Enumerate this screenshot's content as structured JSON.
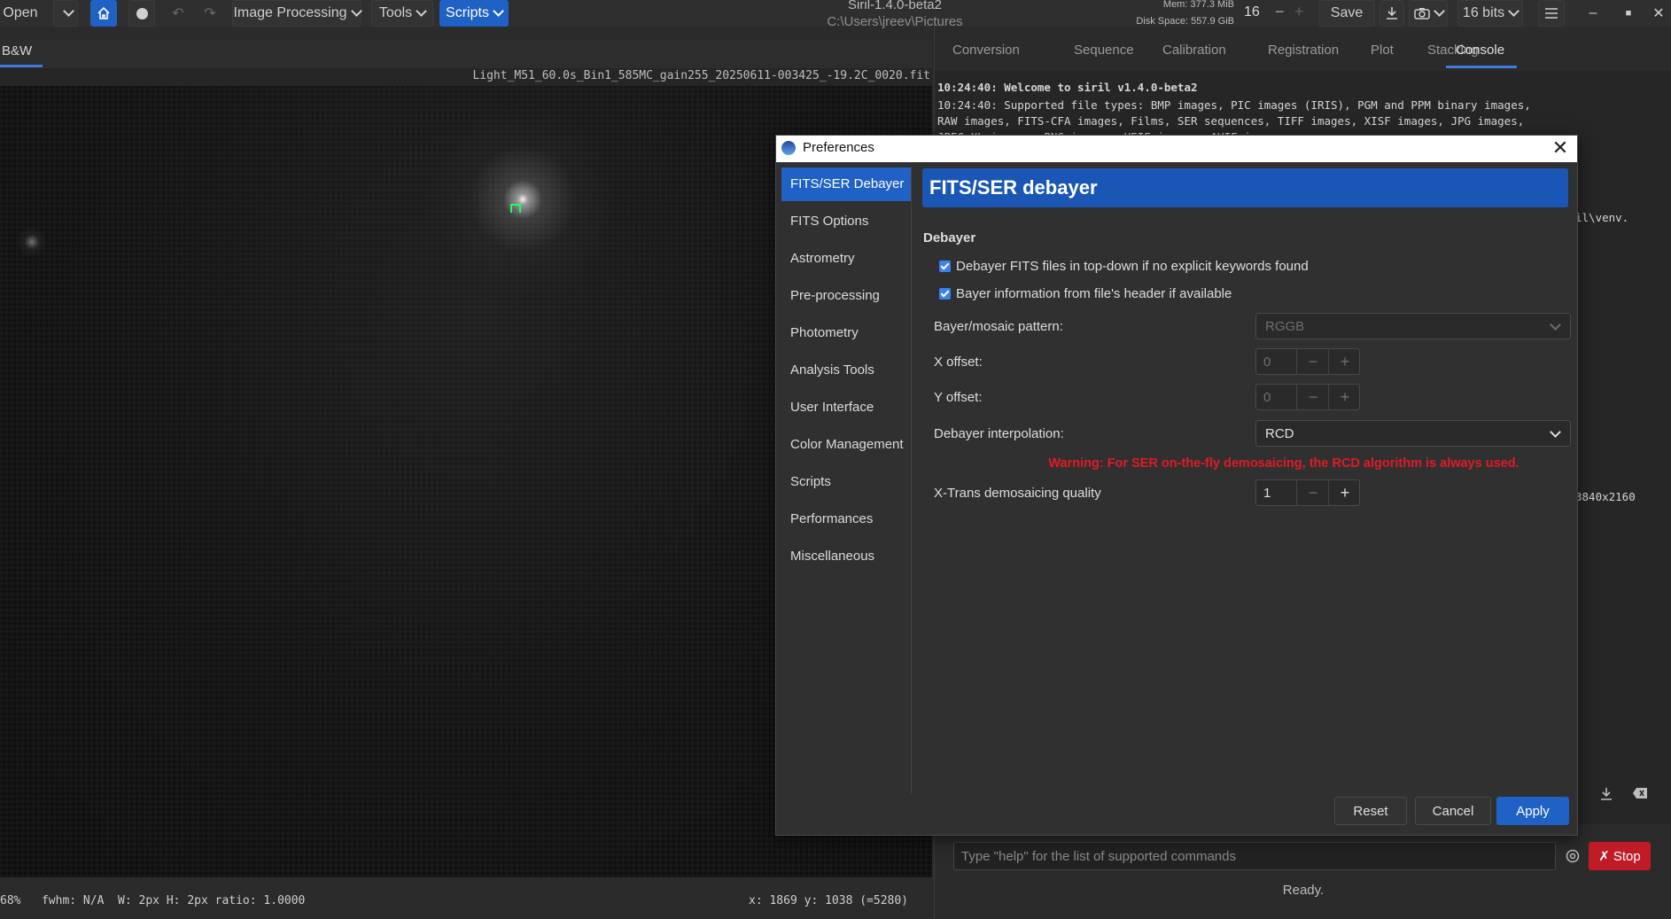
{
  "header": {
    "open_label": "Open",
    "image_processing_label": "Image Processing",
    "tools_label": "Tools",
    "scripts_label": "Scripts",
    "app_title": "Siril-1.4.0-beta2",
    "app_path": "C:\\Users\\jreev\\Pictures",
    "mem": "Mem: 377.3 MiB",
    "disk": "Disk Space: 557.9 GiB",
    "zoom_value": "16",
    "save_label": "Save",
    "bits_label": "16 bits"
  },
  "image_view": {
    "tab_label": "B&W",
    "filename": "Light_M51_60.0s_Bin1_585MC_gain255_20250611-003425_-19.2C_0020.fit",
    "status_left": "68%   fwhm: N/A  W: 2px H: 2px ratio: 1.0000",
    "status_right": "x: 1869 y: 1038 (=5280)"
  },
  "right_panel": {
    "tabs": [
      "Conversion",
      "Sequence",
      "Calibration",
      "Registration",
      "Plot",
      "Stacking",
      "Console"
    ],
    "console_lines": [
      "10:24:40: Welcome to siril v1.4.0-beta2",
      "10:24:40: Supported file types: BMP images, PIC images (IRIS), PGM and PPM binary images,",
      "RAW images, FITS-CFA images, Films, SER sequences, TIFF images, XISF images, JPG images,",
      "JPEG XL images, PNG images, HEIF images, AVIF images."
    ],
    "console_fragment_1": "il\\venv.",
    "console_fragment_2": "3840x2160",
    "command_placeholder": "Type \"help\" for the list of supported commands",
    "stop_label": "Stop",
    "status": "Ready."
  },
  "dialog": {
    "title": "Preferences",
    "sidebar": [
      "FITS/SER Debayer",
      "FITS Options",
      "Astrometry",
      "Pre-processing",
      "Photometry",
      "Analysis Tools",
      "User Interface",
      "Color Management",
      "Scripts",
      "Performances",
      "Miscellaneous"
    ],
    "section_title": "FITS/SER debayer",
    "group_label": "Debayer",
    "checkbox_topdown": "Debayer FITS files in top-down if no explicit keywords found",
    "checkbox_header": "Bayer information from file's header if available",
    "bayer_label": "Bayer/mosaic pattern:",
    "bayer_value": "RGGB",
    "xoffset_label": "X offset:",
    "xoffset_value": "0",
    "yoffset_label": "Y offset:",
    "yoffset_value": "0",
    "interp_label": "Debayer interpolation:",
    "interp_value": "RCD",
    "warning": "Warning: For SER on-the-fly demosaicing, the RCD algorithm is always used.",
    "xtrans_label": "X-Trans demosaicing quality",
    "xtrans_value": "1",
    "reset_label": "Reset",
    "cancel_label": "Cancel",
    "apply_label": "Apply"
  }
}
